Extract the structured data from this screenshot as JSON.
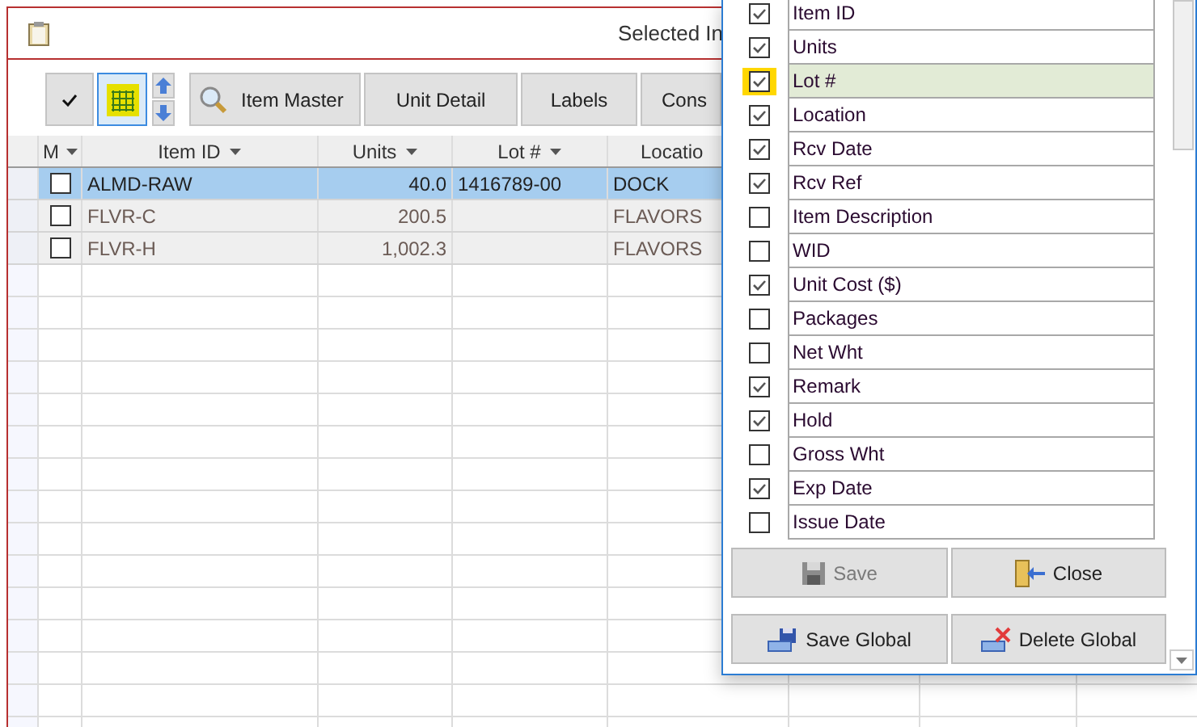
{
  "window": {
    "title": "Selected In"
  },
  "toolbar": {
    "grid_toggle": {
      "selected": true
    },
    "buttons": [
      {
        "label": "Item Master",
        "kind": "search"
      },
      {
        "label": "Unit Detail",
        "kind": "plain"
      },
      {
        "label": "Labels",
        "kind": "plain"
      },
      {
        "label": "Cons",
        "kind": "plain"
      }
    ]
  },
  "grid": {
    "check_column": "M",
    "columns": [
      "Item ID",
      "Units",
      "Lot #",
      "Locatio"
    ],
    "rows": [
      {
        "selected": true,
        "checked": false,
        "cells": [
          "ALMD-RAW",
          "40.0",
          "1416789-00",
          "DOCK"
        ]
      },
      {
        "selected": false,
        "checked": false,
        "cells": [
          "FLVR-C",
          "200.5",
          "",
          "FLAVORS"
        ]
      },
      {
        "selected": false,
        "checked": false,
        "cells": [
          "FLVR-H",
          "1,002.3",
          "",
          "FLAVORS"
        ]
      }
    ]
  },
  "column_chooser": {
    "fields": [
      {
        "label": "Item ID",
        "checked": true,
        "selected": false
      },
      {
        "label": "Units",
        "checked": true,
        "selected": false
      },
      {
        "label": "Lot #",
        "checked": true,
        "selected": true
      },
      {
        "label": "Location",
        "checked": true,
        "selected": false
      },
      {
        "label": "Rcv Date",
        "checked": true,
        "selected": false
      },
      {
        "label": "Rcv Ref",
        "checked": true,
        "selected": false
      },
      {
        "label": "Item Description",
        "checked": false,
        "selected": false
      },
      {
        "label": "WID",
        "checked": false,
        "selected": false
      },
      {
        "label": "Unit Cost ($)",
        "checked": true,
        "selected": false
      },
      {
        "label": "Packages",
        "checked": false,
        "selected": false
      },
      {
        "label": "Net Wht",
        "checked": false,
        "selected": false
      },
      {
        "label": "Remark",
        "checked": true,
        "selected": false
      },
      {
        "label": "Hold",
        "checked": true,
        "selected": false
      },
      {
        "label": "Gross Wht",
        "checked": false,
        "selected": false
      },
      {
        "label": "Exp Date",
        "checked": true,
        "selected": false
      },
      {
        "label": "Issue Date",
        "checked": false,
        "selected": false
      }
    ],
    "buttons": [
      {
        "label": "Save",
        "kind": "save",
        "disabled": true
      },
      {
        "label": "Close",
        "kind": "close",
        "disabled": false
      },
      {
        "label": "Save Global",
        "kind": "save_global",
        "disabled": false
      },
      {
        "label": "Delete Global",
        "kind": "delete_global",
        "disabled": false
      }
    ]
  }
}
